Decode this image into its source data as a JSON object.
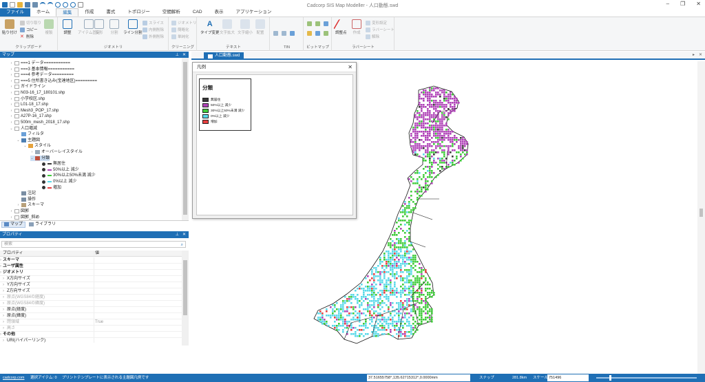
{
  "window": {
    "title": "Cadcorp SIS Map Modeller - 人口動態.swd",
    "minimize": "–",
    "restore": "❐",
    "close": "✕"
  },
  "ribbon_tabs": [
    "ファイル",
    "ホーム",
    "編集",
    "作成",
    "書式",
    "トポロジー",
    "空間解析",
    "CAD",
    "表示",
    "アプリケーション"
  ],
  "ribbon": {
    "clipboard": {
      "label": "クリップボード",
      "paste": "貼り付け",
      "cut": "切り取り",
      "copy": "コピー",
      "delete": "削除",
      "duplicate": "複製"
    },
    "geometry": {
      "label": "ジオメトリ",
      "adjust": "調整",
      "item_fixed": "アイテム固定",
      "transform": "変形",
      "split": "分割",
      "line_split": "ライン分割",
      "slice": "スライス",
      "remove_inner": "内側削除",
      "remove_outer": "外側削除"
    },
    "cleaning": {
      "label": "クリーニング",
      "geometry": "ジオメトリ",
      "simplify": "簡略化",
      "smooth": "単純化"
    },
    "text": {
      "label": "テキスト",
      "type_change": "タイプ変更",
      "char_expand": "文字拡大",
      "char_shrink": "文字縮小",
      "arrange": "配置"
    },
    "tin": {
      "label": "TIN"
    },
    "bitmap": {
      "label": "ビットマップ"
    },
    "rubbersheet": {
      "label": "ラバーシート",
      "control_point": "調整点",
      "create": "作成",
      "transform_setting": "変形設定",
      "rubbersheet": "ラバーシート",
      "release": "解除"
    }
  },
  "map_panel": {
    "title": "マップ",
    "tree": [
      {
        "label": "===1 データ===========",
        "indent": 0,
        "chev": "›",
        "icon": "doc"
      },
      {
        "label": "===3 基本情報===========",
        "indent": 0,
        "chev": "›",
        "icon": "doc"
      },
      {
        "label": "===4 参考データ=========",
        "indent": 0,
        "chev": "›",
        "icon": "doc"
      },
      {
        "label": "===5 住所書き込み(宝達地区)=========",
        "indent": 0,
        "chev": "›",
        "icon": "doc"
      },
      {
        "label": "ガイドライン",
        "indent": 0,
        "chev": "›",
        "icon": "doc"
      },
      {
        "label": "N03-16_17_180101.shp",
        "indent": 0,
        "chev": "›",
        "icon": "doc"
      },
      {
        "label": "小学校区.shp",
        "indent": 0,
        "chev": "›",
        "icon": "doc"
      },
      {
        "label": "L01-18_17.shp",
        "indent": 0,
        "chev": "›",
        "icon": "doc"
      },
      {
        "label": "Mesh3_POP_17.shp",
        "indent": 0,
        "chev": "›",
        "icon": "doc"
      },
      {
        "label": "A27P-16_17.shp",
        "indent": 0,
        "chev": "›",
        "icon": "doc"
      },
      {
        "label": "500m_mesh_2018_17.shp",
        "indent": 0,
        "chev": "›",
        "icon": "doc"
      },
      {
        "label": "人口増減",
        "indent": 0,
        "chev": "⌄",
        "icon": "doc"
      },
      {
        "label": "フィルタ",
        "indent": 1,
        "chev": "",
        "icon": "filter"
      },
      {
        "label": "主題図",
        "indent": 1,
        "chev": "⌄",
        "icon": "theme"
      },
      {
        "label": "スタイル",
        "indent": 2,
        "chev": "⌄",
        "icon": "style"
      },
      {
        "label": "オーバーレイスタイル",
        "indent": 3,
        "chev": "›",
        "icon": "overlay"
      },
      {
        "label": "分類",
        "indent": 3,
        "chev": "⌄",
        "icon": "class",
        "selected": true
      },
      {
        "label": "無居住",
        "indent": 4,
        "chev": "",
        "icon": "dot",
        "color": "#3a3a3a"
      },
      {
        "label": "50%以上 減少",
        "indent": 4,
        "chev": "",
        "icon": "dot",
        "color": "#b044b8"
      },
      {
        "label": "30%以上50%未満 減少",
        "indent": 4,
        "chev": "",
        "icon": "dot",
        "color": "#3fcb3a"
      },
      {
        "label": "0%以上 減少",
        "indent": 4,
        "chev": "",
        "icon": "dot",
        "color": "#5ad9e8"
      },
      {
        "label": "増加",
        "indent": 4,
        "chev": "",
        "icon": "dot",
        "color": "#e84040"
      },
      {
        "label": "注記",
        "indent": 1,
        "chev": "",
        "icon": "note"
      },
      {
        "label": "操作",
        "indent": 1,
        "chev": "",
        "icon": "op"
      },
      {
        "label": "スキーマ",
        "indent": 1,
        "chev": "›",
        "icon": "schema"
      },
      {
        "label": "図郭",
        "indent": 0,
        "chev": "›",
        "icon": "doc"
      },
      {
        "label": "図郭_斜め",
        "indent": 0,
        "chev": "›",
        "icon": "doc"
      }
    ],
    "tabs": [
      "マップ",
      "ライブラリ"
    ]
  },
  "properties": {
    "title": "プロパティ",
    "search_placeholder": "検索",
    "col_property": "プロパティ",
    "col_value": "値",
    "rows": [
      {
        "k": "スキーマ",
        "v": "",
        "type": "cat"
      },
      {
        "k": "ユーザ属性",
        "v": "",
        "type": "cat"
      },
      {
        "k": "ジオメトリ",
        "v": "",
        "type": "cat"
      },
      {
        "k": "X方向サイズ",
        "v": "",
        "type": "row"
      },
      {
        "k": "Y方向サイズ",
        "v": "",
        "type": "row"
      },
      {
        "k": "Z方向サイズ",
        "v": "",
        "type": "row"
      },
      {
        "k": "原点(WGS84の経度)",
        "v": "",
        "type": "dim"
      },
      {
        "k": "原点(WGS84の緯度)",
        "v": "",
        "type": "dim"
      },
      {
        "k": "原点(経度)",
        "v": "",
        "type": "row"
      },
      {
        "k": "原点(緯度)",
        "v": "",
        "type": "row"
      },
      {
        "k": "閉領域",
        "v": "True",
        "type": "dim"
      },
      {
        "k": "高さ",
        "v": "",
        "type": "dim"
      },
      {
        "k": "その他",
        "v": "",
        "type": "cat"
      },
      {
        "k": "URI(ハイパーリンク)",
        "v": "",
        "type": "row"
      }
    ]
  },
  "document_tab": "人口動態.swd",
  "legend": {
    "window_title": "凡例",
    "title": "分類",
    "items": [
      {
        "label": "無居住",
        "color": "#3a3a3a"
      },
      {
        "label": "50%以上 減少",
        "color": "#b044b8"
      },
      {
        "label": "30%以上50%未満 減少",
        "color": "#3fcb3a"
      },
      {
        "label": "0%以上 減少",
        "color": "#5ad9e8"
      },
      {
        "label": "増加",
        "color": "#e84040"
      }
    ]
  },
  "status": {
    "link": "cadcorp.com",
    "selected": "選択アイテム: 0",
    "message": "プリントテンプレートに表示される主題図凡例です",
    "coords": "37.51655758°,135.62715312°,0.0000mm",
    "snap": "スナップ",
    "distance": "281.8km",
    "scale_label": "スケール:",
    "scale_value": "751496"
  }
}
